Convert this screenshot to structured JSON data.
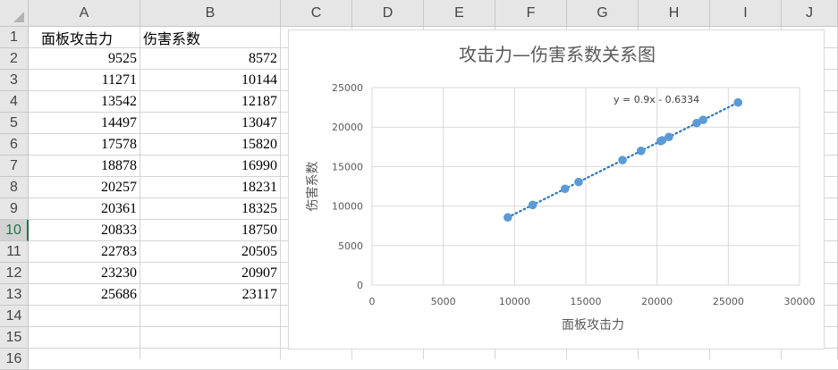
{
  "columns": [
    "A",
    "B",
    "C",
    "D",
    "E",
    "F",
    "G",
    "H",
    "I",
    "J"
  ],
  "rows": [
    "1",
    "2",
    "3",
    "4",
    "5",
    "6",
    "7",
    "8",
    "9",
    "10",
    "11",
    "12",
    "13",
    "14",
    "15",
    "16"
  ],
  "selected_row": "10",
  "header_row": {
    "a": "面板攻击力",
    "b": "伤害系数"
  },
  "table": [
    [
      9525,
      8572
    ],
    [
      11271,
      10144
    ],
    [
      13542,
      12187
    ],
    [
      14497,
      13047
    ],
    [
      17578,
      15820
    ],
    [
      18878,
      16990
    ],
    [
      20257,
      18231
    ],
    [
      20361,
      18325
    ],
    [
      20833,
      18750
    ],
    [
      22783,
      20505
    ],
    [
      23230,
      20907
    ],
    [
      25686,
      23117
    ]
  ],
  "chart_data": {
    "type": "scatter",
    "title": "攻击力—伤害系数关系图",
    "xlabel": "面板攻击力",
    "ylabel": "伤害系数",
    "xlim": [
      0,
      30000
    ],
    "ylim": [
      0,
      25000
    ],
    "xticks": [
      0,
      5000,
      10000,
      15000,
      20000,
      25000,
      30000
    ],
    "yticks": [
      0,
      5000,
      10000,
      15000,
      20000,
      25000
    ],
    "grid": true,
    "points": [
      [
        9525,
        8572
      ],
      [
        11271,
        10144
      ],
      [
        13542,
        12187
      ],
      [
        14497,
        13047
      ],
      [
        17578,
        15820
      ],
      [
        18878,
        16990
      ],
      [
        20257,
        18231
      ],
      [
        20361,
        18325
      ],
      [
        20833,
        18750
      ],
      [
        22783,
        20505
      ],
      [
        23230,
        20907
      ],
      [
        25686,
        23117
      ]
    ],
    "trendline": {
      "label": "y = 0.9x - 0.6334",
      "slope": 0.9,
      "intercept": -0.6334,
      "style": "dotted"
    },
    "colors": {
      "marker": "#5b9bd5",
      "trend": "#2e75b6",
      "grid": "#d9d9d9",
      "text": "#595959"
    }
  }
}
